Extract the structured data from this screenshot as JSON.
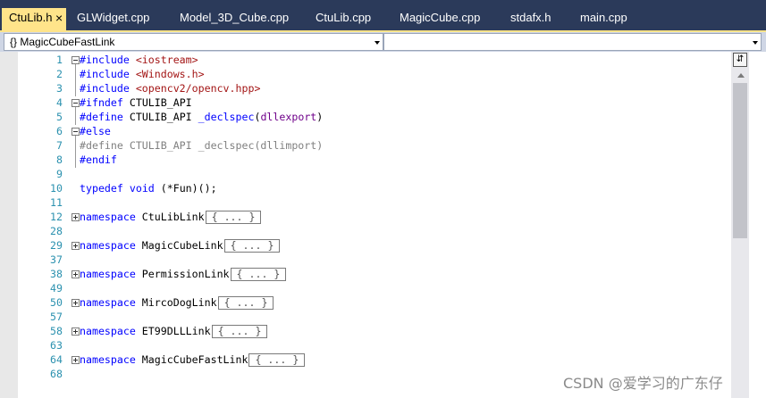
{
  "tabs": [
    {
      "label": "CtuLib.h",
      "active": true,
      "close": "×"
    },
    {
      "label": "GLWidget.cpp"
    },
    {
      "label": "Model_3D_Cube.cpp"
    },
    {
      "label": "CtuLib.cpp"
    },
    {
      "label": "MagicCube.cpp"
    },
    {
      "label": "stdafx.h"
    },
    {
      "label": "main.cpp"
    }
  ],
  "navigation": {
    "scope_icon": "{}",
    "scope": "MagicCubeFastLink",
    "member": ""
  },
  "editor": {
    "collapsed_marker": "{ ... }",
    "lines": [
      {
        "n": "1",
        "tokens": [
          {
            "t": "#include",
            "c": "kw"
          },
          {
            "t": " <iostream>",
            "c": "str"
          }
        ],
        "fold": "minus"
      },
      {
        "n": "2",
        "tokens": [
          {
            "t": "#include",
            "c": "kw"
          },
          {
            "t": " <Windows.h>",
            "c": "str"
          }
        ]
      },
      {
        "n": "3",
        "tokens": [
          {
            "t": "#include",
            "c": "kw"
          },
          {
            "t": " <opencv2/opencv.hpp>",
            "c": "str"
          }
        ]
      },
      {
        "n": "4",
        "tokens": [
          {
            "t": "#ifndef",
            "c": "kw"
          },
          {
            "t": " CTULIB_API",
            "c": ""
          }
        ],
        "fold": "minus"
      },
      {
        "n": "5",
        "tokens": [
          {
            "t": "#define",
            "c": "kw"
          },
          {
            "t": " CTULIB_API ",
            "c": ""
          },
          {
            "t": "_declspec",
            "c": "kw"
          },
          {
            "t": "(",
            "c": ""
          },
          {
            "t": "dllexport",
            "c": "mac"
          },
          {
            "t": ")",
            "c": ""
          }
        ]
      },
      {
        "n": "6",
        "tokens": [
          {
            "t": "#else",
            "c": "kw"
          }
        ],
        "fold": "minus"
      },
      {
        "n": "7",
        "tokens": [
          {
            "t": "#define CTULIB_API _declspec(dllimport)",
            "c": "dead"
          }
        ]
      },
      {
        "n": "8",
        "tokens": [
          {
            "t": "#endif",
            "c": "kw"
          }
        ]
      },
      {
        "n": "9",
        "tokens": []
      },
      {
        "n": "10",
        "tokens": [
          {
            "t": "typedef",
            "c": "kw"
          },
          {
            "t": " ",
            "c": ""
          },
          {
            "t": "void",
            "c": "kw"
          },
          {
            "t": " (*Fun)();",
            "c": ""
          }
        ]
      },
      {
        "n": "11",
        "tokens": []
      },
      {
        "n": "12",
        "tokens": [
          {
            "t": "namespace",
            "c": "kw"
          },
          {
            "t": " CtuLibLink",
            "c": ""
          }
        ],
        "fold": "plus",
        "collapsed": true
      },
      {
        "n": "28",
        "tokens": []
      },
      {
        "n": "29",
        "tokens": [
          {
            "t": "namespace",
            "c": "kw"
          },
          {
            "t": " MagicCubeLink",
            "c": ""
          }
        ],
        "fold": "plus",
        "collapsed": true
      },
      {
        "n": "37",
        "tokens": []
      },
      {
        "n": "38",
        "tokens": [
          {
            "t": "namespace",
            "c": "kw"
          },
          {
            "t": " PermissionLink",
            "c": ""
          }
        ],
        "fold": "plus",
        "collapsed": true
      },
      {
        "n": "49",
        "tokens": []
      },
      {
        "n": "50",
        "tokens": [
          {
            "t": "namespace",
            "c": "kw"
          },
          {
            "t": " MircoDogLink",
            "c": ""
          }
        ],
        "fold": "plus",
        "collapsed": true
      },
      {
        "n": "57",
        "tokens": []
      },
      {
        "n": "58",
        "tokens": [
          {
            "t": "namespace",
            "c": "kw"
          },
          {
            "t": " ET99DLLLink",
            "c": ""
          }
        ],
        "fold": "plus",
        "collapsed": true
      },
      {
        "n": "63",
        "tokens": []
      },
      {
        "n": "64",
        "tokens": [
          {
            "t": "namespace",
            "c": "kw"
          },
          {
            "t": " MagicCubeFastLink",
            "c": ""
          }
        ],
        "fold": "plus",
        "collapsed": true
      },
      {
        "n": "68",
        "tokens": []
      }
    ]
  },
  "scrollbar": {
    "split_button": "⇵"
  },
  "watermark": "CSDN @爱学习的广东仔",
  "colors": {
    "tab_strip": "#2b3a5a",
    "active_tab": "#ffe48a",
    "line_number": "#2b91af",
    "keyword": "#0000ff",
    "string": "#a31515",
    "macro": "#6f008a",
    "inactive_code": "#808080"
  },
  "icons": [
    "close-icon",
    "dropdown-arrow-icon",
    "fold-minus-icon",
    "fold-plus-icon",
    "split-window-icon",
    "scroll-up-icon"
  ]
}
